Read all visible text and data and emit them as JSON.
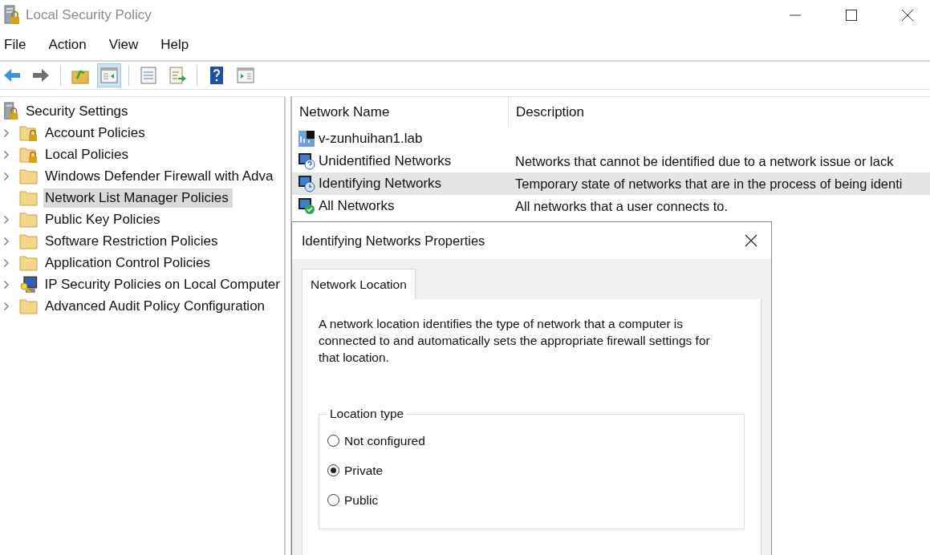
{
  "window": {
    "title": "Local Security Policy"
  },
  "menu": [
    "File",
    "Action",
    "View",
    "Help"
  ],
  "toolbar": [
    {
      "kind": "back",
      "pressed": false
    },
    {
      "kind": "forward",
      "pressed": false
    },
    {
      "kind": "up",
      "pressed": false
    },
    {
      "kind": "tree",
      "pressed": true
    },
    {
      "kind": "properties",
      "pressed": false
    },
    {
      "kind": "export",
      "pressed": false
    },
    {
      "kind": "help",
      "pressed": false
    },
    {
      "kind": "actionpane",
      "pressed": false
    }
  ],
  "tree": {
    "label": "Security Settings",
    "children": [
      {
        "label": "Account Policies",
        "kind": "lockfolder",
        "expandable": true,
        "selected": false
      },
      {
        "label": "Local Policies",
        "kind": "lockfolder",
        "expandable": true,
        "selected": false
      },
      {
        "label": "Windows Defender Firewall with Adva",
        "kind": "folder",
        "expandable": true,
        "selected": false
      },
      {
        "label": "Network List Manager Policies",
        "kind": "folder",
        "expandable": false,
        "selected": true
      },
      {
        "label": "Public Key Policies",
        "kind": "folder",
        "expandable": true,
        "selected": false
      },
      {
        "label": "Software Restriction Policies",
        "kind": "folder",
        "expandable": true,
        "selected": false
      },
      {
        "label": "Application Control Policies",
        "kind": "folder",
        "expandable": true,
        "selected": false
      },
      {
        "label": "IP Security Policies on Local Computer",
        "kind": "ipsec",
        "expandable": true,
        "selected": false
      },
      {
        "label": "Advanced Audit Policy Configuration",
        "kind": "folder",
        "expandable": true,
        "selected": false
      }
    ]
  },
  "table": {
    "columns": [
      "Network Name",
      "Description"
    ],
    "rows": [
      {
        "name": "v-zunhuihan1.lab",
        "description": "",
        "kind": "domain",
        "selected": false
      },
      {
        "name": "Unidentified Networks",
        "description": "Networks that cannot be identified due to a network issue or lack",
        "kind": "unknown",
        "selected": false
      },
      {
        "name": "Identifying Networks",
        "description": "Temporary state of networks that are in the process of being identi",
        "kind": "identifying",
        "selected": true
      },
      {
        "name": "All Networks",
        "description": "All networks that a user connects to.",
        "kind": "all",
        "selected": false
      }
    ]
  },
  "dialog": {
    "title": "Identifying Networks Properties",
    "tabs": [
      {
        "label": "Network Location",
        "selected": true
      }
    ],
    "description": "A network location identifies the type of network that a computer is connected to and automatically sets the appropriate firewall settings for that location.",
    "group": {
      "label": "Location type",
      "options": [
        {
          "label": "Not configured",
          "selected": false
        },
        {
          "label": "Private",
          "selected": true
        },
        {
          "label": "Public",
          "selected": false
        }
      ]
    }
  }
}
